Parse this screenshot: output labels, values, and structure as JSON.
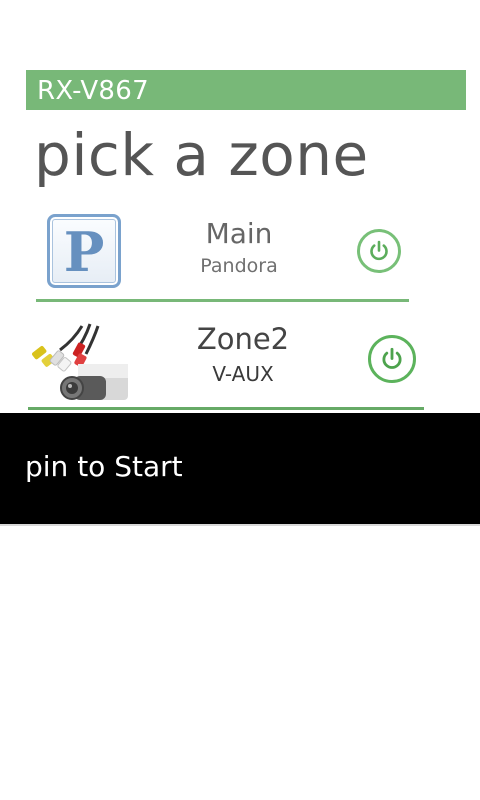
{
  "header": {
    "title": "RX-V867",
    "accent_color": "#78b878"
  },
  "page_title": "pick a zone",
  "zones": [
    {
      "name": "Main",
      "source": "Pandora",
      "icon": "pandora-icon",
      "icon_letter": "P",
      "power_icon": "power-icon"
    },
    {
      "name": "Zone2",
      "source": "V-AUX",
      "icon": "av-cable-camcorder-icon",
      "power_icon": "power-icon"
    }
  ],
  "app_bar": {
    "menu_items": [
      {
        "label": "pin to Start"
      }
    ]
  }
}
